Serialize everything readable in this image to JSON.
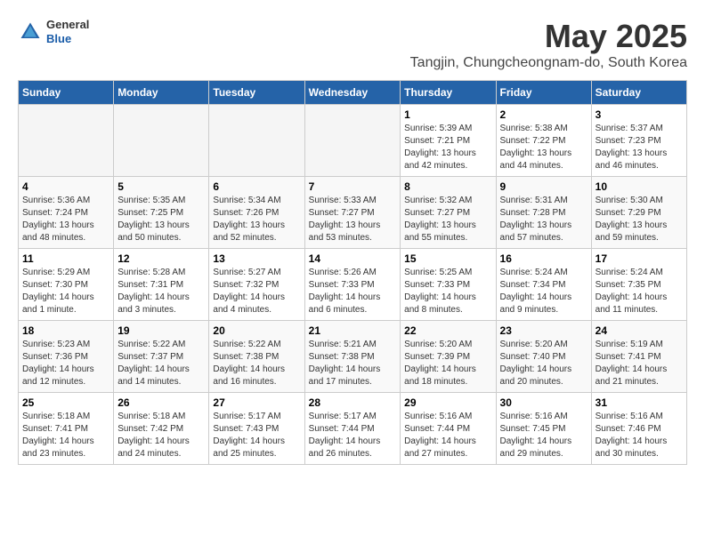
{
  "header": {
    "logo_general": "General",
    "logo_blue": "Blue",
    "month_title": "May 2025",
    "location": "Tangjin, Chungcheongnam-do, South Korea"
  },
  "weekdays": [
    "Sunday",
    "Monday",
    "Tuesday",
    "Wednesday",
    "Thursday",
    "Friday",
    "Saturday"
  ],
  "weeks": [
    [
      {
        "num": "",
        "info": ""
      },
      {
        "num": "",
        "info": ""
      },
      {
        "num": "",
        "info": ""
      },
      {
        "num": "",
        "info": ""
      },
      {
        "num": "1",
        "info": "Sunrise: 5:39 AM\nSunset: 7:21 PM\nDaylight: 13 hours\nand 42 minutes."
      },
      {
        "num": "2",
        "info": "Sunrise: 5:38 AM\nSunset: 7:22 PM\nDaylight: 13 hours\nand 44 minutes."
      },
      {
        "num": "3",
        "info": "Sunrise: 5:37 AM\nSunset: 7:23 PM\nDaylight: 13 hours\nand 46 minutes."
      }
    ],
    [
      {
        "num": "4",
        "info": "Sunrise: 5:36 AM\nSunset: 7:24 PM\nDaylight: 13 hours\nand 48 minutes."
      },
      {
        "num": "5",
        "info": "Sunrise: 5:35 AM\nSunset: 7:25 PM\nDaylight: 13 hours\nand 50 minutes."
      },
      {
        "num": "6",
        "info": "Sunrise: 5:34 AM\nSunset: 7:26 PM\nDaylight: 13 hours\nand 52 minutes."
      },
      {
        "num": "7",
        "info": "Sunrise: 5:33 AM\nSunset: 7:27 PM\nDaylight: 13 hours\nand 53 minutes."
      },
      {
        "num": "8",
        "info": "Sunrise: 5:32 AM\nSunset: 7:27 PM\nDaylight: 13 hours\nand 55 minutes."
      },
      {
        "num": "9",
        "info": "Sunrise: 5:31 AM\nSunset: 7:28 PM\nDaylight: 13 hours\nand 57 minutes."
      },
      {
        "num": "10",
        "info": "Sunrise: 5:30 AM\nSunset: 7:29 PM\nDaylight: 13 hours\nand 59 minutes."
      }
    ],
    [
      {
        "num": "11",
        "info": "Sunrise: 5:29 AM\nSunset: 7:30 PM\nDaylight: 14 hours\nand 1 minute."
      },
      {
        "num": "12",
        "info": "Sunrise: 5:28 AM\nSunset: 7:31 PM\nDaylight: 14 hours\nand 3 minutes."
      },
      {
        "num": "13",
        "info": "Sunrise: 5:27 AM\nSunset: 7:32 PM\nDaylight: 14 hours\nand 4 minutes."
      },
      {
        "num": "14",
        "info": "Sunrise: 5:26 AM\nSunset: 7:33 PM\nDaylight: 14 hours\nand 6 minutes."
      },
      {
        "num": "15",
        "info": "Sunrise: 5:25 AM\nSunset: 7:33 PM\nDaylight: 14 hours\nand 8 minutes."
      },
      {
        "num": "16",
        "info": "Sunrise: 5:24 AM\nSunset: 7:34 PM\nDaylight: 14 hours\nand 9 minutes."
      },
      {
        "num": "17",
        "info": "Sunrise: 5:24 AM\nSunset: 7:35 PM\nDaylight: 14 hours\nand 11 minutes."
      }
    ],
    [
      {
        "num": "18",
        "info": "Sunrise: 5:23 AM\nSunset: 7:36 PM\nDaylight: 14 hours\nand 12 minutes."
      },
      {
        "num": "19",
        "info": "Sunrise: 5:22 AM\nSunset: 7:37 PM\nDaylight: 14 hours\nand 14 minutes."
      },
      {
        "num": "20",
        "info": "Sunrise: 5:22 AM\nSunset: 7:38 PM\nDaylight: 14 hours\nand 16 minutes."
      },
      {
        "num": "21",
        "info": "Sunrise: 5:21 AM\nSunset: 7:38 PM\nDaylight: 14 hours\nand 17 minutes."
      },
      {
        "num": "22",
        "info": "Sunrise: 5:20 AM\nSunset: 7:39 PM\nDaylight: 14 hours\nand 18 minutes."
      },
      {
        "num": "23",
        "info": "Sunrise: 5:20 AM\nSunset: 7:40 PM\nDaylight: 14 hours\nand 20 minutes."
      },
      {
        "num": "24",
        "info": "Sunrise: 5:19 AM\nSunset: 7:41 PM\nDaylight: 14 hours\nand 21 minutes."
      }
    ],
    [
      {
        "num": "25",
        "info": "Sunrise: 5:18 AM\nSunset: 7:41 PM\nDaylight: 14 hours\nand 23 minutes."
      },
      {
        "num": "26",
        "info": "Sunrise: 5:18 AM\nSunset: 7:42 PM\nDaylight: 14 hours\nand 24 minutes."
      },
      {
        "num": "27",
        "info": "Sunrise: 5:17 AM\nSunset: 7:43 PM\nDaylight: 14 hours\nand 25 minutes."
      },
      {
        "num": "28",
        "info": "Sunrise: 5:17 AM\nSunset: 7:44 PM\nDaylight: 14 hours\nand 26 minutes."
      },
      {
        "num": "29",
        "info": "Sunrise: 5:16 AM\nSunset: 7:44 PM\nDaylight: 14 hours\nand 27 minutes."
      },
      {
        "num": "30",
        "info": "Sunrise: 5:16 AM\nSunset: 7:45 PM\nDaylight: 14 hours\nand 29 minutes."
      },
      {
        "num": "31",
        "info": "Sunrise: 5:16 AM\nSunset: 7:46 PM\nDaylight: 14 hours\nand 30 minutes."
      }
    ]
  ]
}
